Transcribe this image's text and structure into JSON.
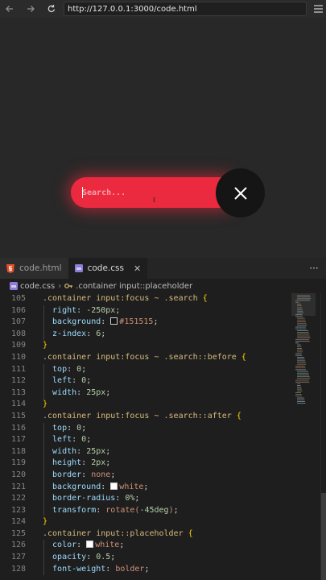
{
  "browser": {
    "url": "http://127.0.0.1:3000/code.html"
  },
  "preview": {
    "search_placeholder": "Search..."
  },
  "tabs": [
    {
      "label": "code.html",
      "icon": "html5-icon",
      "active": false
    },
    {
      "label": "code.css",
      "icon": "css-file-icon",
      "active": true
    }
  ],
  "breadcrumb": {
    "file": "code.css",
    "symbol": ".container input::placeholder"
  },
  "colors": {
    "accent_red": "#ec2a3f",
    "dark_circle": "#151515",
    "editor_bg": "#1e1e1e"
  },
  "code_lines": [
    {
      "n": "105",
      "segs": [
        [
          "sel",
          ".container input:focus ~ .search "
        ],
        [
          "brace",
          "{"
        ]
      ]
    },
    {
      "n": "106",
      "segs": [
        [
          "prop",
          "  right"
        ],
        [
          "punc",
          ": "
        ],
        [
          "num",
          "-250px"
        ],
        [
          "punc",
          ";"
        ]
      ]
    },
    {
      "n": "107",
      "segs": [
        [
          "prop",
          "  background"
        ],
        [
          "punc",
          ": "
        ],
        [
          "swatch",
          "#151515"
        ],
        [
          "val",
          "#151515"
        ],
        [
          "punc",
          ";"
        ]
      ]
    },
    {
      "n": "108",
      "segs": [
        [
          "prop",
          "  z-index"
        ],
        [
          "punc",
          ": "
        ],
        [
          "num",
          "6"
        ],
        [
          "punc",
          ";"
        ]
      ]
    },
    {
      "n": "109",
      "segs": [
        [
          "brace",
          "}"
        ]
      ]
    },
    {
      "n": "110",
      "segs": [
        [
          "sel",
          ".container input:focus ~ .search::before "
        ],
        [
          "brace",
          "{"
        ]
      ]
    },
    {
      "n": "111",
      "segs": [
        [
          "prop",
          "  top"
        ],
        [
          "punc",
          ": "
        ],
        [
          "num",
          "0"
        ],
        [
          "punc",
          ";"
        ]
      ]
    },
    {
      "n": "112",
      "segs": [
        [
          "prop",
          "  left"
        ],
        [
          "punc",
          ": "
        ],
        [
          "num",
          "0"
        ],
        [
          "punc",
          ";"
        ]
      ]
    },
    {
      "n": "113",
      "segs": [
        [
          "prop",
          "  width"
        ],
        [
          "punc",
          ": "
        ],
        [
          "num",
          "25px"
        ],
        [
          "punc",
          ";"
        ]
      ]
    },
    {
      "n": "114",
      "segs": [
        [
          "brace",
          "}"
        ]
      ]
    },
    {
      "n": "115",
      "segs": [
        [
          "sel",
          ".container input:focus ~ .search::after "
        ],
        [
          "brace",
          "{"
        ]
      ]
    },
    {
      "n": "116",
      "segs": [
        [
          "prop",
          "  top"
        ],
        [
          "punc",
          ": "
        ],
        [
          "num",
          "0"
        ],
        [
          "punc",
          ";"
        ]
      ]
    },
    {
      "n": "117",
      "segs": [
        [
          "prop",
          "  left"
        ],
        [
          "punc",
          ": "
        ],
        [
          "num",
          "0"
        ],
        [
          "punc",
          ";"
        ]
      ]
    },
    {
      "n": "118",
      "segs": [
        [
          "prop",
          "  width"
        ],
        [
          "punc",
          ": "
        ],
        [
          "num",
          "25px"
        ],
        [
          "punc",
          ";"
        ]
      ]
    },
    {
      "n": "119",
      "segs": [
        [
          "prop",
          "  height"
        ],
        [
          "punc",
          ": "
        ],
        [
          "num",
          "2px"
        ],
        [
          "punc",
          ";"
        ]
      ]
    },
    {
      "n": "120",
      "segs": [
        [
          "prop",
          "  border"
        ],
        [
          "punc",
          ": "
        ],
        [
          "val",
          "none"
        ],
        [
          "punc",
          ";"
        ]
      ]
    },
    {
      "n": "121",
      "segs": [
        [
          "prop",
          "  background"
        ],
        [
          "punc",
          ": "
        ],
        [
          "swatch",
          "#ffffff"
        ],
        [
          "val",
          "white"
        ],
        [
          "punc",
          ";"
        ]
      ]
    },
    {
      "n": "122",
      "segs": [
        [
          "prop",
          "  border-radius"
        ],
        [
          "punc",
          ": "
        ],
        [
          "num",
          "0%"
        ],
        [
          "punc",
          ";"
        ]
      ]
    },
    {
      "n": "123",
      "segs": [
        [
          "prop",
          "  transform"
        ],
        [
          "punc",
          ": "
        ],
        [
          "val",
          "rotate("
        ],
        [
          "num",
          "-45deg"
        ],
        [
          "val",
          ")"
        ],
        [
          "punc",
          ";"
        ]
      ]
    },
    {
      "n": "124",
      "segs": [
        [
          "brace",
          "}"
        ]
      ]
    },
    {
      "n": "125",
      "segs": [
        [
          "sel",
          ".container input::placeholder "
        ],
        [
          "brace",
          "{"
        ]
      ]
    },
    {
      "n": "126",
      "segs": [
        [
          "prop",
          "  color"
        ],
        [
          "punc",
          ": "
        ],
        [
          "swatch",
          "#ffffff"
        ],
        [
          "val",
          "white"
        ],
        [
          "punc",
          ";"
        ]
      ]
    },
    {
      "n": "127",
      "segs": [
        [
          "prop",
          "  opacity"
        ],
        [
          "punc",
          ": "
        ],
        [
          "num",
          "0.5"
        ],
        [
          "punc",
          ";"
        ]
      ]
    },
    {
      "n": "128",
      "segs": [
        [
          "prop",
          "  font-weight"
        ],
        [
          "punc",
          ": "
        ],
        [
          "val",
          "bolder"
        ],
        [
          "punc",
          ";"
        ]
      ]
    }
  ]
}
